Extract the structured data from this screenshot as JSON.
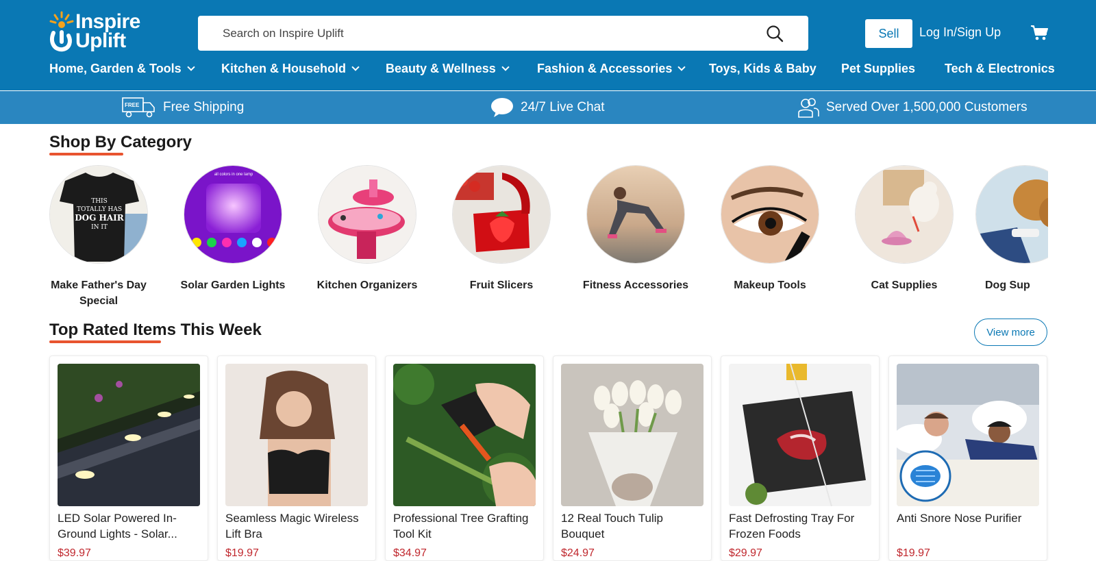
{
  "header": {
    "logo_line1": "Inspire",
    "logo_line2": "Uplift",
    "search_placeholder": "Search on Inspire Uplift",
    "sell_label": "Sell",
    "login_label": "Log In/Sign Up",
    "brand_color": "#0a78b4"
  },
  "nav": [
    {
      "label": "Home, Garden & Tools",
      "has_dropdown": true
    },
    {
      "label": "Kitchen & Household",
      "has_dropdown": true
    },
    {
      "label": "Beauty & Wellness",
      "has_dropdown": true
    },
    {
      "label": "Fashion & Accessories",
      "has_dropdown": true
    },
    {
      "label": "Toys, Kids & Baby",
      "has_dropdown": false
    },
    {
      "label": "Pet Supplies",
      "has_dropdown": false
    },
    {
      "label": "Tech & Electronics",
      "has_dropdown": false
    }
  ],
  "benefits": [
    {
      "label": "Free Shipping",
      "icon": "free-shipping-truck-icon",
      "badge": "FREE"
    },
    {
      "label": "24/7 Live Chat",
      "icon": "chat-bubble-icon"
    },
    {
      "label": "Served Over 1,500,000 Customers",
      "icon": "customers-icon"
    }
  ],
  "categories_section": {
    "title": "Shop By Category",
    "items": [
      {
        "label": "Make Father's Day Special",
        "image": "t-shirt-photo",
        "shirt_text": "THIS TOTALLY HAS DOG HAIR IN IT"
      },
      {
        "label": "Solar Garden Lights",
        "image": "solar-lamp-photo",
        "caption": "all colors in one lamp"
      },
      {
        "label": "Kitchen Organizers",
        "image": "organizer-photo"
      },
      {
        "label": "Fruit Slicers",
        "image": "strawberry-slicer-photo"
      },
      {
        "label": "Fitness Accessories",
        "image": "fitness-photo"
      },
      {
        "label": "Makeup Tools",
        "image": "eyeliner-photo"
      },
      {
        "label": "Cat Supplies",
        "image": "cat-toy-photo"
      },
      {
        "label": "Dog Sup",
        "image": "dog-grooming-photo"
      }
    ]
  },
  "top_rated": {
    "title": "Top Rated Items This Week",
    "view_more": "View more",
    "products": [
      {
        "title": "LED Solar Powered In-Ground Lights - Solar...",
        "price": "$39.97",
        "image": "ground-lights-photo"
      },
      {
        "title": "Seamless Magic Wireless Lift Bra",
        "price": "$19.97",
        "image": "bra-photo"
      },
      {
        "title": "Professional Tree Grafting Tool Kit",
        "price": "$34.97",
        "image": "grafting-tool-photo"
      },
      {
        "title": "12 Real Touch Tulip Bouquet",
        "price": "$24.97",
        "image": "tulip-photo"
      },
      {
        "title": "Fast Defrosting Tray For Frozen Foods",
        "price": "$29.97",
        "image": "defrost-tray-photo"
      },
      {
        "title": "Anti Snore Nose Purifier",
        "price": "$19.97",
        "image": "snore-photo"
      }
    ]
  },
  "colors": {
    "accent_underline": "#e8542f",
    "price": "#c0272d"
  }
}
